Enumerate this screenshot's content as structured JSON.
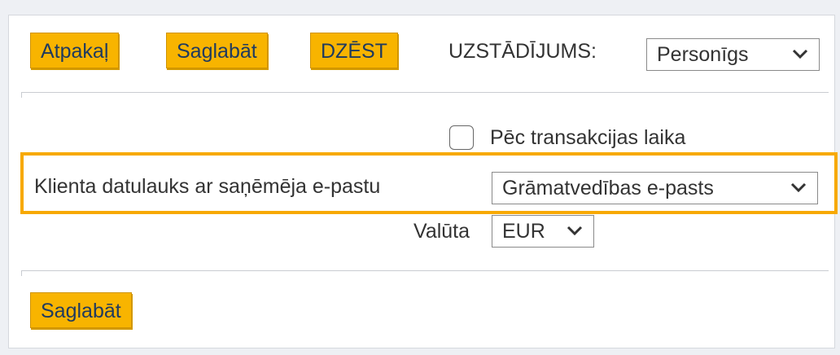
{
  "toolbar": {
    "back_label": "Atpakaļ",
    "save_label": "Saglabāt",
    "delete_label": "DZĒST",
    "setting_label": "UZSTĀDĪJUMS:",
    "setting_value": "Personīgs"
  },
  "form": {
    "transaction_time_label": "Pēc transakcijas laika",
    "transaction_time_checked": false,
    "client_field_label": "Klienta datulauks ar saņēmēja e-pastu",
    "client_field_value": "Grāmatvedības e-pasts",
    "currency_label": "Valūta",
    "currency_value": "EUR"
  },
  "footer": {
    "save_label": "Saglabāt"
  },
  "colors": {
    "button_bg": "#f8b400",
    "button_text": "#1f3a5f",
    "highlight": "#f7a900"
  },
  "icons": {
    "dropdown": "chevron-down-icon"
  }
}
